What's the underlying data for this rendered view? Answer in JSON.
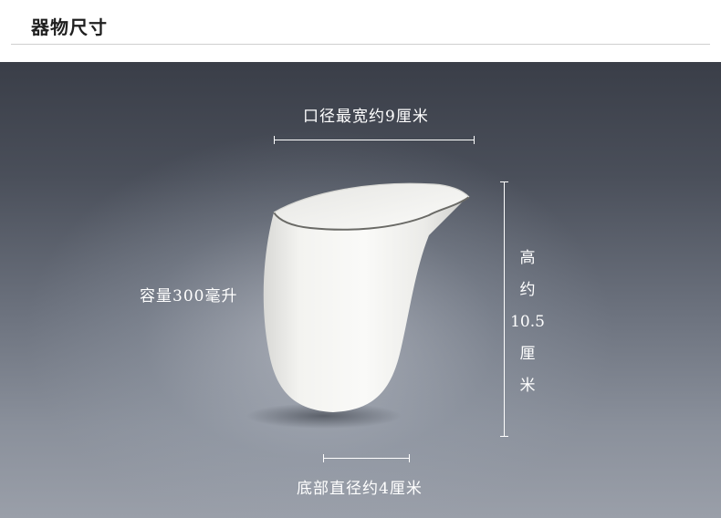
{
  "header": {
    "title": "器物尺寸"
  },
  "dimensions": {
    "rim_width": "口径最宽约9厘米",
    "capacity": "容量300毫升",
    "height_lines": [
      "高",
      "约",
      "10.5",
      "厘",
      "米"
    ],
    "base_diameter": "底部直径约4厘米"
  },
  "colors": {
    "background_top": "#3a3e48",
    "background_bottom": "#9a9fa9",
    "label_text": "#ffffff",
    "header_text": "#1f1f1f"
  }
}
